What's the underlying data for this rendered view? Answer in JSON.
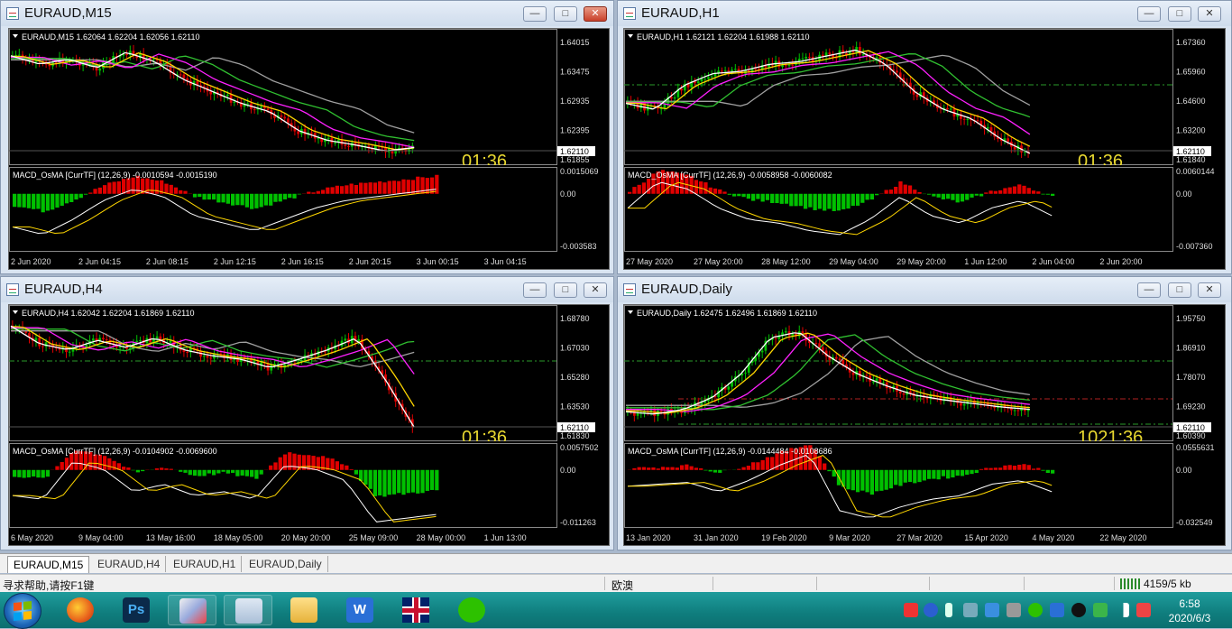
{
  "windows": [
    {
      "title": "EURAUD,M15",
      "info": "EURAUD,M15  1.62064 1.62204 1.62056 1.62110",
      "price_labels": [
        "1.64015",
        "1.63475",
        "1.62935",
        "1.62395",
        "1.61855"
      ],
      "current_price": "1.62110",
      "timer": "01:36",
      "macd_info": "MACD_OsMA [CurrTF] (12,26,9) -0.0010594 -0.0015190",
      "macd_labels": [
        "0.0015069",
        "0.00",
        "-0.003583"
      ],
      "time_labels": [
        "2 Jun 2020",
        "2 Jun 04:15",
        "2 Jun 08:15",
        "2 Jun 12:15",
        "2 Jun 16:15",
        "2 Jun 20:15",
        "3 Jun 00:15",
        "3 Jun 04:15"
      ]
    },
    {
      "title": "EURAUD,H1",
      "info": "EURAUD,H1  1.62121 1.62204 1.61988 1.62110",
      "price_labels": [
        "1.67360",
        "1.65960",
        "1.64600",
        "1.63200",
        "1.61840"
      ],
      "current_price": "1.62110",
      "timer": "01:36",
      "macd_info": "MACD_OsMA [CurrTF] (12,26,9) -0.0058958 -0.0060082",
      "macd_labels": [
        "0.0060144",
        "0.00",
        "-0.007360"
      ],
      "time_labels": [
        "27 May 2020",
        "27 May 20:00",
        "28 May 12:00",
        "29 May 04:00",
        "29 May 20:00",
        "1 Jun 12:00",
        "2 Jun 04:00",
        "2 Jun 20:00"
      ]
    },
    {
      "title": "EURAUD,H4",
      "info": "EURAUD,H4  1.62042 1.62204 1.61869 1.62110",
      "price_labels": [
        "1.68780",
        "1.67030",
        "1.65280",
        "1.63530",
        "1.61830"
      ],
      "current_price": "1.62110",
      "timer": "01:36",
      "macd_info": "MACD_OsMA [CurrTF] (12,26,9) -0.0104902 -0.0069600",
      "macd_labels": [
        "0.0057502",
        "0.00",
        "-0.011263"
      ],
      "time_labels": [
        "6 May 2020",
        "9 May 04:00",
        "13 May 16:00",
        "18 May 05:00",
        "20 May 20:00",
        "25 May 09:00",
        "28 May 00:00",
        "1 Jun 13:00"
      ]
    },
    {
      "title": "EURAUD,Daily",
      "info": "EURAUD,Daily  1.62475 1.62496 1.61869 1.62110",
      "price_labels": [
        "1.95750",
        "1.86910",
        "1.78070",
        "1.69230",
        "1.60390"
      ],
      "current_price": "1.62110",
      "timer": "1021:36",
      "macd_info": "MACD_OsMA [CurrTF] (12,26,9) -0.0144484 -0.0108686",
      "macd_labels": [
        "0.0555631",
        "0.00",
        "-0.032549"
      ],
      "time_labels": [
        "13 Jan 2020",
        "31 Jan 2020",
        "19 Feb 2020",
        "9 Mar 2020",
        "27 Mar 2020",
        "15 Apr 2020",
        "4 May 2020",
        "22 May 2020"
      ]
    }
  ],
  "tabs": [
    "EURAUD,M15",
    "EURAUD,H4",
    "EURAUD,H1",
    "EURAUD,Daily"
  ],
  "status": {
    "help": "寻求帮助,请按F1键",
    "profile": "欧澳",
    "traffic": "4159/5 kb"
  },
  "taskbar": {
    "time": "6:58",
    "date": "2020/6/3",
    "apps": [
      "firefox-icon",
      "photoshop-icon",
      "paint-icon",
      "metatrader-icon",
      "explorer-icon",
      "wps-icon",
      "uk-flag-icon",
      "wechat-icon"
    ]
  },
  "colors": {
    "candle_up": "#00c000",
    "candle_down": "#e00000",
    "ma_fast": "#ffffff",
    "ma_yellow": "#ffd700",
    "ma_magenta": "#ff20ff",
    "ma_green": "#30c030",
    "ma_gray": "#a0a0a0"
  }
}
